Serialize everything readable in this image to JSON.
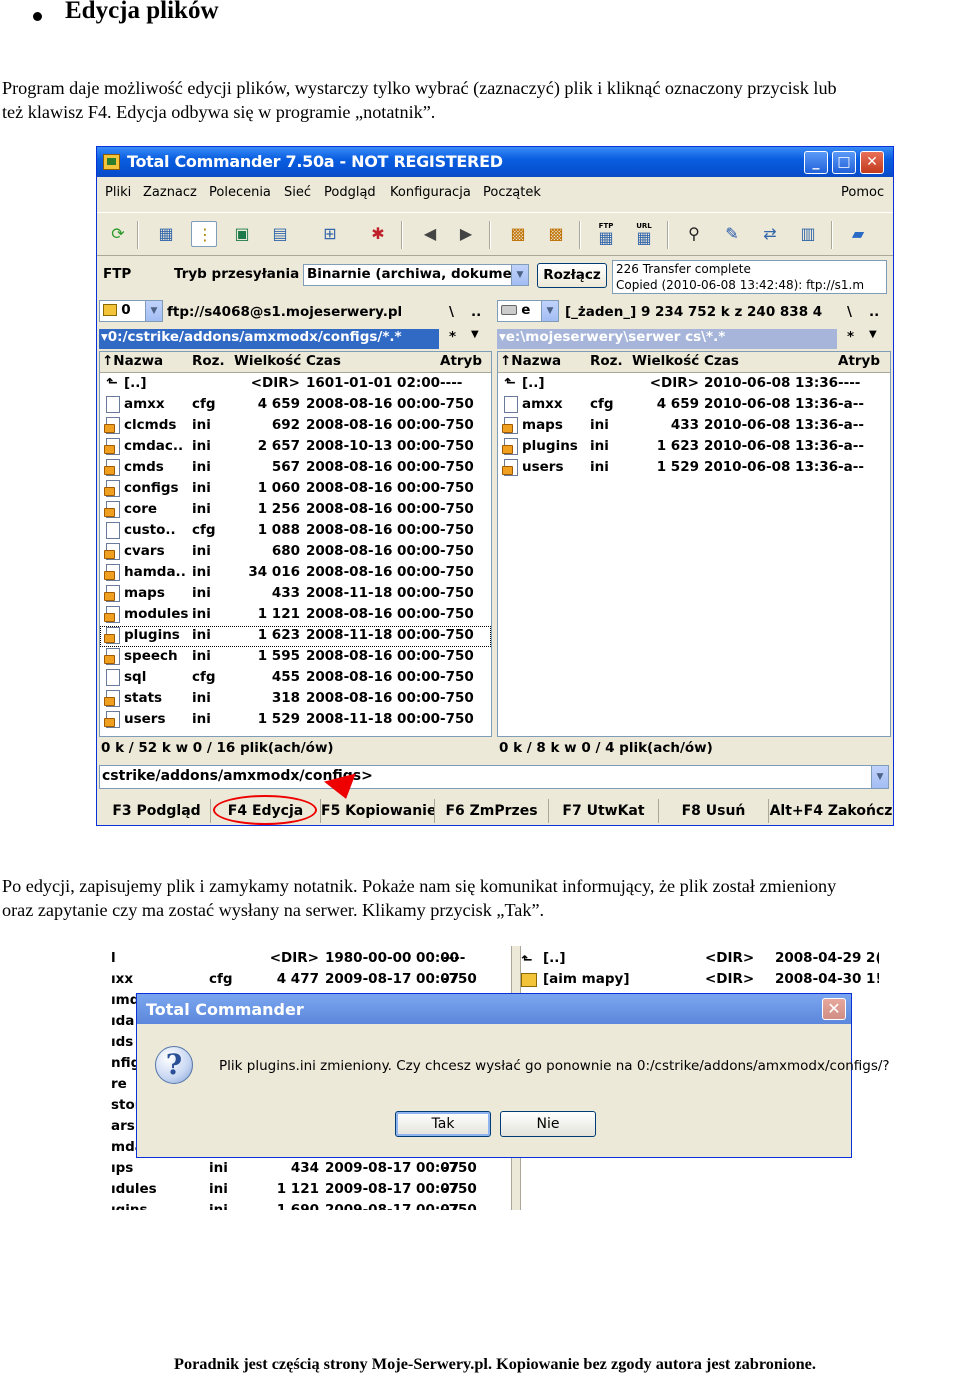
{
  "doc": {
    "heading": "Edycja plików",
    "para1_line1": "Program daje możliwość edycji plików, wystarczy tylko wybrać (zaznaczyć) plik i kliknąć oznaczony przycisk lub",
    "para1_line2": "też klawisz F4. Edycja odbywa się w programie „notatnik”.",
    "para2_line1": "Po edycji, zapisujemy plik i zamykamy notatnik. Pokaże nam się komunikat informujący, że plik został zmieniony",
    "para2_line2": "oraz zapytanie czy ma zostać wysłany na serwer. Klikamy przycisk „Tak”.",
    "footer": "Poradnik jest częścią strony Moje-Serwery.pl. Kopiowanie bez zgody autora jest zabronione."
  },
  "tc": {
    "title": "Total Commander 7.50a - NOT REGISTERED",
    "window_buttons": {
      "minimize": "_",
      "maximize": "□",
      "close": "✕"
    },
    "menu": [
      "Pliki",
      "Zaznacz",
      "Polecenia",
      "Sieć",
      "Podgląd",
      "Konfiguracja",
      "Początek"
    ],
    "menu_right": "Pomoc",
    "toolbar_icons": [
      "refresh-icon",
      "brief-view-icon",
      "full-view-icon",
      "thumbnails-icon",
      "tree-icon",
      "invert-selection-icon",
      "unpack-icon",
      "back-icon",
      "forward-icon",
      "pack-icon",
      "unpack-files-icon",
      "ftp-connect-icon",
      "ftp-url-icon",
      "find-icon",
      "multi-rename-icon",
      "sync-dirs-icon",
      "compare-icon",
      "notepad-icon"
    ],
    "toolbar_labels": {
      "ftp": "FTP",
      "url": "URL"
    },
    "ftp": {
      "label": "FTP",
      "mode_label": "Tryb przesyłania",
      "mode_value": "Binarnie (archiwa, dokumen",
      "disconnect": "Rozłącz",
      "log_line1": "226 Transfer complete",
      "log_line2": "Copied (2010-06-08 13:42:48): ftp://s1.m"
    },
    "left": {
      "drive": "0",
      "drive_path": "ftp://s4068@s1.mojeserwery.pl",
      "nav": "\\",
      "up": "..",
      "path": "▾0:/cstrike/addons/amxmodx/configs/*.*",
      "star": "*",
      "headers": {
        "name": "↑Nazwa",
        "ext": "Roz.",
        "size": "Wielkość",
        "date": "Czas",
        "attr": "Atryb"
      },
      "rows": [
        {
          "name": "[..]",
          "ext": "",
          "size": "<DIR>",
          "date": "1601-01-01 02:00",
          "attr": "----"
        },
        {
          "name": "amxx",
          "ext": "cfg",
          "size": "4 659",
          "date": "2008-08-16 00:00",
          "attr": "-750"
        },
        {
          "name": "clcmds",
          "ext": "ini",
          "size": "692",
          "date": "2008-08-16 00:00",
          "attr": "-750"
        },
        {
          "name": "cmdac..",
          "ext": "ini",
          "size": "2 657",
          "date": "2008-10-13 00:00",
          "attr": "-750"
        },
        {
          "name": "cmds",
          "ext": "ini",
          "size": "567",
          "date": "2008-08-16 00:00",
          "attr": "-750"
        },
        {
          "name": "configs",
          "ext": "ini",
          "size": "1 060",
          "date": "2008-08-16 00:00",
          "attr": "-750"
        },
        {
          "name": "core",
          "ext": "ini",
          "size": "1 256",
          "date": "2008-08-16 00:00",
          "attr": "-750"
        },
        {
          "name": "custo..",
          "ext": "cfg",
          "size": "1 088",
          "date": "2008-08-16 00:00",
          "attr": "-750"
        },
        {
          "name": "cvars",
          "ext": "ini",
          "size": "680",
          "date": "2008-08-16 00:00",
          "attr": "-750"
        },
        {
          "name": "hamda..",
          "ext": "ini",
          "size": "34 016",
          "date": "2008-08-16 00:00",
          "attr": "-750"
        },
        {
          "name": "maps",
          "ext": "ini",
          "size": "433",
          "date": "2008-11-18 00:00",
          "attr": "-750"
        },
        {
          "name": "modules",
          "ext": "ini",
          "size": "1 121",
          "date": "2008-08-16 00:00",
          "attr": "-750"
        },
        {
          "name": "plugins",
          "ext": "ini",
          "size": "1 623",
          "date": "2008-11-18 00:00",
          "attr": "-750"
        },
        {
          "name": "speech",
          "ext": "ini",
          "size": "1 595",
          "date": "2008-08-16 00:00",
          "attr": "-750"
        },
        {
          "name": "sql",
          "ext": "cfg",
          "size": "455",
          "date": "2008-08-16 00:00",
          "attr": "-750"
        },
        {
          "name": "stats",
          "ext": "ini",
          "size": "318",
          "date": "2008-08-16 00:00",
          "attr": "-750"
        },
        {
          "name": "users",
          "ext": "ini",
          "size": "1 529",
          "date": "2008-11-18 00:00",
          "attr": "-750"
        }
      ],
      "status": "0 k / 52 k w 0 / 16 plik(ach/ów)"
    },
    "right": {
      "drive": "e",
      "drive_info": "[_żaden_]  9 234 752 k z 240 838 4",
      "nav": "\\",
      "up": "..",
      "path": "▾e:\\mojeserwery\\serwer cs\\*.*",
      "star": "*",
      "headers": {
        "name": "↑Nazwa",
        "ext": "Roz.",
        "size": "Wielkość",
        "date": "Czas",
        "attr": "Atryb"
      },
      "rows": [
        {
          "name": "[..]",
          "ext": "",
          "size": "<DIR>",
          "date": "2010-06-08 13:36",
          "attr": "----"
        },
        {
          "name": "amxx",
          "ext": "cfg",
          "size": "4 659",
          "date": "2010-06-08 13:36",
          "attr": "-a--"
        },
        {
          "name": "maps",
          "ext": "ini",
          "size": "433",
          "date": "2010-06-08 13:36",
          "attr": "-a--"
        },
        {
          "name": "plugins",
          "ext": "ini",
          "size": "1 623",
          "date": "2010-06-08 13:36",
          "attr": "-a--"
        },
        {
          "name": "users",
          "ext": "ini",
          "size": "1 529",
          "date": "2010-06-08 13:36",
          "attr": "-a--"
        }
      ],
      "status": "0 k / 8 k w 0 / 4 plik(ach/ów)"
    },
    "command_line": "cstrike/addons/amxmodx/configs>",
    "fkeys": [
      "F3 Podgląd",
      "F4 Edycja",
      "F5 Kopiowanie",
      "F6 ZmPrzes",
      "F7 UtwKat",
      "F8 Usuń",
      "Alt+F4 Zakończ"
    ],
    "highlight_color": "#e00000"
  },
  "shot2": {
    "left_rows": [
      {
        "name": "l",
        "ext": "",
        "size": "<DIR>",
        "date": "1980-00-00 00:00",
        "attr": "----"
      },
      {
        "name": "ıxx",
        "ext": "cfg",
        "size": "4 477",
        "date": "2009-08-17 00:07",
        "attr": "-750"
      },
      {
        "name": "ımd",
        "ext": "",
        "size": "",
        "date": "",
        "attr": ""
      },
      {
        "name": "ıdа",
        "ext": "",
        "size": "",
        "date": "",
        "attr": ""
      },
      {
        "name": "ıds",
        "ext": "",
        "size": "",
        "date": "",
        "attr": ""
      },
      {
        "name": "nfig",
        "ext": "",
        "size": "",
        "date": "",
        "attr": ""
      },
      {
        "name": "re",
        "ext": "",
        "size": "",
        "date": "",
        "attr": ""
      },
      {
        "name": "stor",
        "ext": "",
        "size": "",
        "date": "",
        "attr": ""
      },
      {
        "name": "ars",
        "ext": "",
        "size": "",
        "date": "",
        "attr": ""
      },
      {
        "name": "mda",
        "ext": "",
        "size": "",
        "date": "",
        "attr": ""
      },
      {
        "name": "ıps",
        "ext": "ini",
        "size": "434",
        "date": "2009-08-17 00:07",
        "attr": "-750"
      },
      {
        "name": "ıdules",
        "ext": "ini",
        "size": "1 121",
        "date": "2009-08-17 00:07",
        "attr": "-750"
      },
      {
        "name": "ıgins",
        "ext": "ini",
        "size": "1 690",
        "date": "2009-08-17 00:07",
        "attr": "-750"
      }
    ],
    "right_rows": [
      {
        "name": "[..]",
        "size": "<DIR>",
        "date": "2008-04-29 2("
      },
      {
        "name": "[aim mapy]",
        "size": "<DIR>",
        "date": "2008-04-30 1!"
      }
    ],
    "dialog": {
      "title": "Total Commander",
      "close": "✕",
      "icon": "?",
      "message": "Plik plugins.ini zmieniony. Czy chcesz wysłać go ponownie na 0:/cstrike/addons/amxmodx/configs/?",
      "yes": "Tak",
      "no": "Nie"
    }
  }
}
